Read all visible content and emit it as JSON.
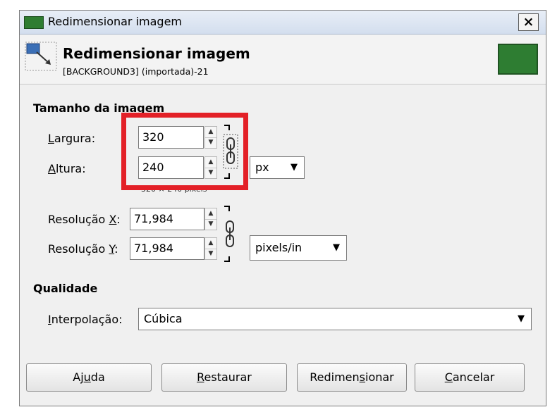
{
  "window": {
    "title": "Redimensionar imagem",
    "close_label": "×"
  },
  "header": {
    "title": "Redimensionar imagem",
    "subtitle": "[BACKGROUND3] (importada)-21",
    "thumbnail_color": "#2e7d32"
  },
  "size_section": {
    "title": "Tamanho da imagem",
    "width_label_u": "L",
    "width_label_rest": "argura:",
    "width_value": "320",
    "height_label_u": "A",
    "height_label_rest": "ltura:",
    "height_value": "240",
    "unit": "px",
    "size_note": "320 × 240 pixels"
  },
  "resolution": {
    "x_label_pre": "Resolução ",
    "x_label_u": "X",
    "x_label_post": ":",
    "x_value": "71,984",
    "y_label_pre": "Resolução ",
    "y_label_u": "Y",
    "y_label_post": ":",
    "y_value": "71,984",
    "unit": "pixels/in"
  },
  "quality": {
    "title": "Qualidade",
    "interp_label_u": "I",
    "interp_label_rest": "nterpolação:",
    "interp_value": "Cúbica"
  },
  "buttons": {
    "help_pre": "Aj",
    "help_u": "u",
    "help_post": "da",
    "reset_u": "R",
    "reset_post": "estaurar",
    "resize_pre": "Redimen",
    "resize_u": "s",
    "resize_post": "ionar",
    "cancel_u": "C",
    "cancel_post": "ancelar"
  },
  "highlight_color": "#e32027",
  "icons": [
    "window-icon",
    "resize-icon",
    "chain-icon",
    "spin-up-icon",
    "spin-down-icon",
    "dropdown-arrow-icon"
  ]
}
